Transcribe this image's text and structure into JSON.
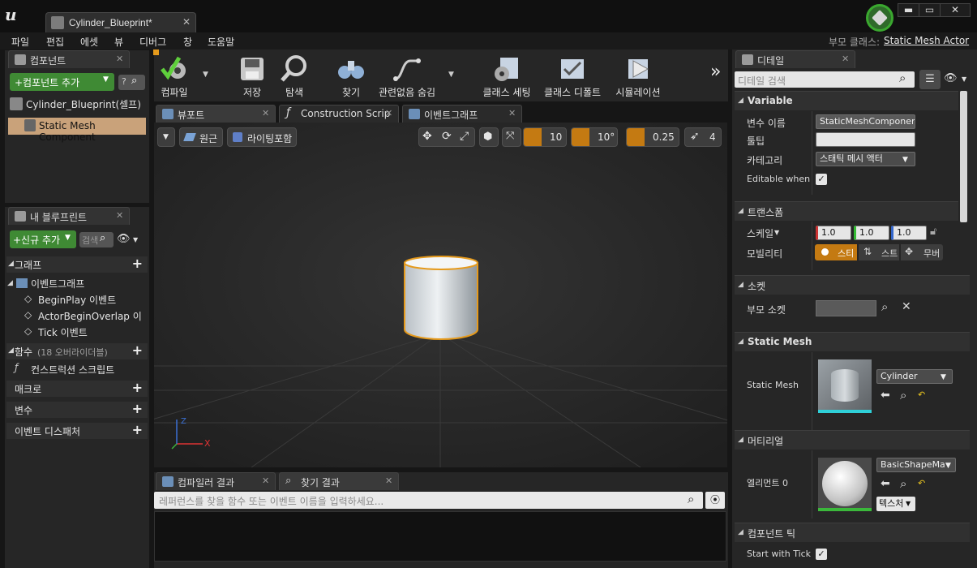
{
  "app": {
    "tab_title": "Cylinder_Blueprint*",
    "parent_class_label": "부모 클래스:",
    "parent_class_value": "Static Mesh Actor"
  },
  "window_controls": {
    "minimize": "▬",
    "maximize": "▭",
    "close": "✕"
  },
  "menu": [
    "파일",
    "편집",
    "에셋",
    "뷰",
    "디버그",
    "창",
    "도움말"
  ],
  "components_panel": {
    "tab": "컴포넌트",
    "add_button": "+컴포넌트 추가",
    "search_placeholder": "?",
    "root_item": "Cylinder_Blueprint(셀프)",
    "selected_item": "Static Mesh Component"
  },
  "my_blueprint_panel": {
    "tab": "내 블루프린트",
    "new_button": "+신규 추가",
    "search_placeholder": "검색",
    "sections": {
      "graphs": "그래프",
      "event_graph": "이벤트그래프",
      "events": [
        "BeginPlay 이벤트",
        "ActorBeginOverlap 이벤",
        "Tick 이벤트"
      ],
      "functions": "함수",
      "functions_note": "(18 오버라이더블)",
      "construction_script": "컨스트럭션 스크립트",
      "macros": "매크로",
      "variables": "변수",
      "event_dispatchers": "이벤트 디스패처"
    }
  },
  "toolbar": {
    "compile": "컴파일",
    "save": "저장",
    "browse": "탐색",
    "find": "찾기",
    "hide_unrelated": "관련없음 숨김",
    "class_settings": "클래스 세팅",
    "class_defaults": "클래스 디폴트",
    "simulation": "시뮬레이션",
    "overflow": "»"
  },
  "editor_tabs": [
    "뷰포트",
    "Construction Scrip",
    "이벤트그래프"
  ],
  "viewport": {
    "perspective_button": "원근",
    "lighting_button": "라이팅포함",
    "grid_snap": "10",
    "rotation_snap": "10°",
    "scale_snap": "0.25",
    "camera_speed": "4",
    "axis_x": "X",
    "axis_z": "Z"
  },
  "results_panel": {
    "tabs": [
      "컴파일러 결과",
      "찾기 결과"
    ],
    "search_placeholder": "레퍼런스를 찾을 함수 또는 이벤트 이름을 입력하세요..."
  },
  "details_panel": {
    "tab": "디테일",
    "search_placeholder": "디테일 검색",
    "sections": {
      "variable": "Variable",
      "transform": "트랜스폼",
      "sockets": "소켓",
      "static_mesh": "Static Mesh",
      "materials": "머티리얼",
      "component_tick": "컴포넌트 틱"
    },
    "variable_name_label": "변수 이름",
    "variable_name_value": "StaticMeshComponent",
    "tooltip_label": "툴팁",
    "tooltip_value": "",
    "category_label": "카테고리",
    "category_value": "스태틱 메시 액터",
    "editable_label": "Editable when In",
    "scale_label": "스케일",
    "scale_x": "1.0",
    "scale_y": "1.0",
    "scale_z": "1.0",
    "mobility_label": "모빌리티",
    "mobility_options": [
      "스티",
      "스트",
      "무버"
    ],
    "parent_socket_label": "부모 소켓",
    "static_mesh_label": "Static Mesh",
    "static_mesh_value": "Cylinder",
    "element_label": "엘리먼트 0",
    "material_value": "BasicShapeMate",
    "textures_button": "텍스처",
    "start_with_tick_label": "Start with Tick E"
  },
  "colors": {
    "accent_green": "#3f8a34",
    "selection_orange": "#e59a1c",
    "selected_row": "#c9a27a"
  }
}
